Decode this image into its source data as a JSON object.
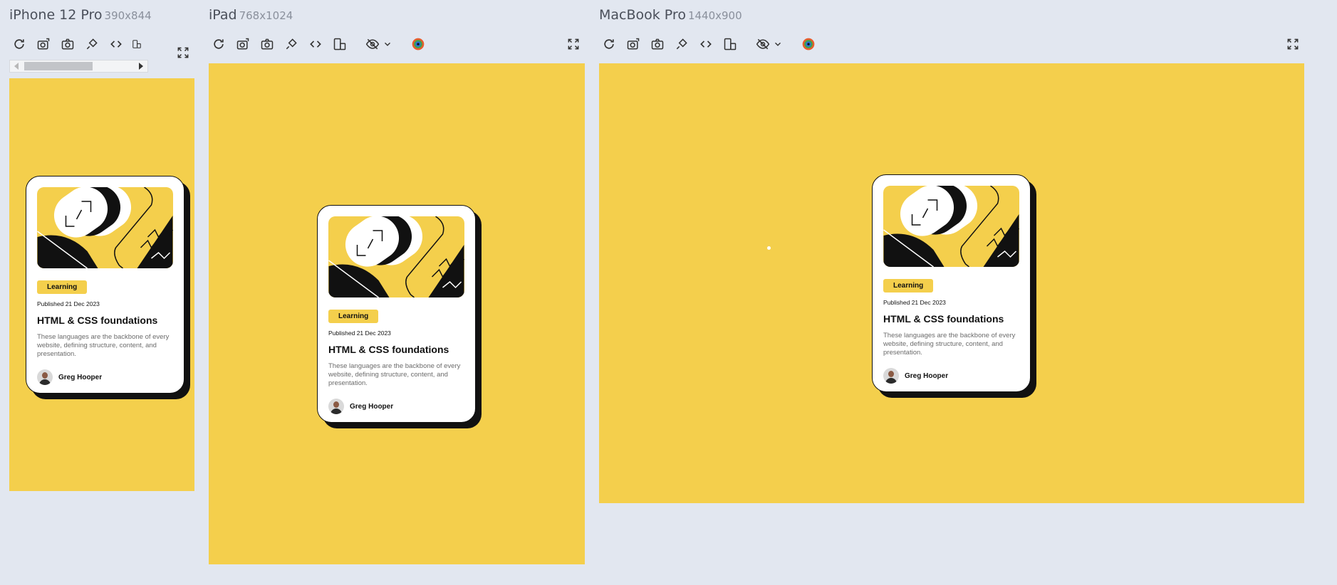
{
  "devices": [
    {
      "name": "iPhone 12 Pro",
      "size": "390x844"
    },
    {
      "name": "iPad",
      "size": "768x1024"
    },
    {
      "name": "MacBook Pro",
      "size": "1440x900"
    }
  ],
  "toolbar": {
    "icons": [
      "reload-icon",
      "screenshot-full-icon",
      "screenshot-icon",
      "network-throttle-icon",
      "code-icon",
      "rotate-device-icon",
      "hide-icon",
      "chevron-down-icon",
      "colorblind-icon",
      "fullscreen-icon"
    ]
  },
  "card": {
    "tag": "Learning",
    "published": "Published 21 Dec 2023",
    "title": "HTML & CSS foundations",
    "description": "These languages are the backbone of every website, defining structure, content, and presentation.",
    "author": "Greg Hooper"
  },
  "colors": {
    "background": "#f4cf4c",
    "page": "#e2e7f0",
    "ink": "#111111"
  }
}
